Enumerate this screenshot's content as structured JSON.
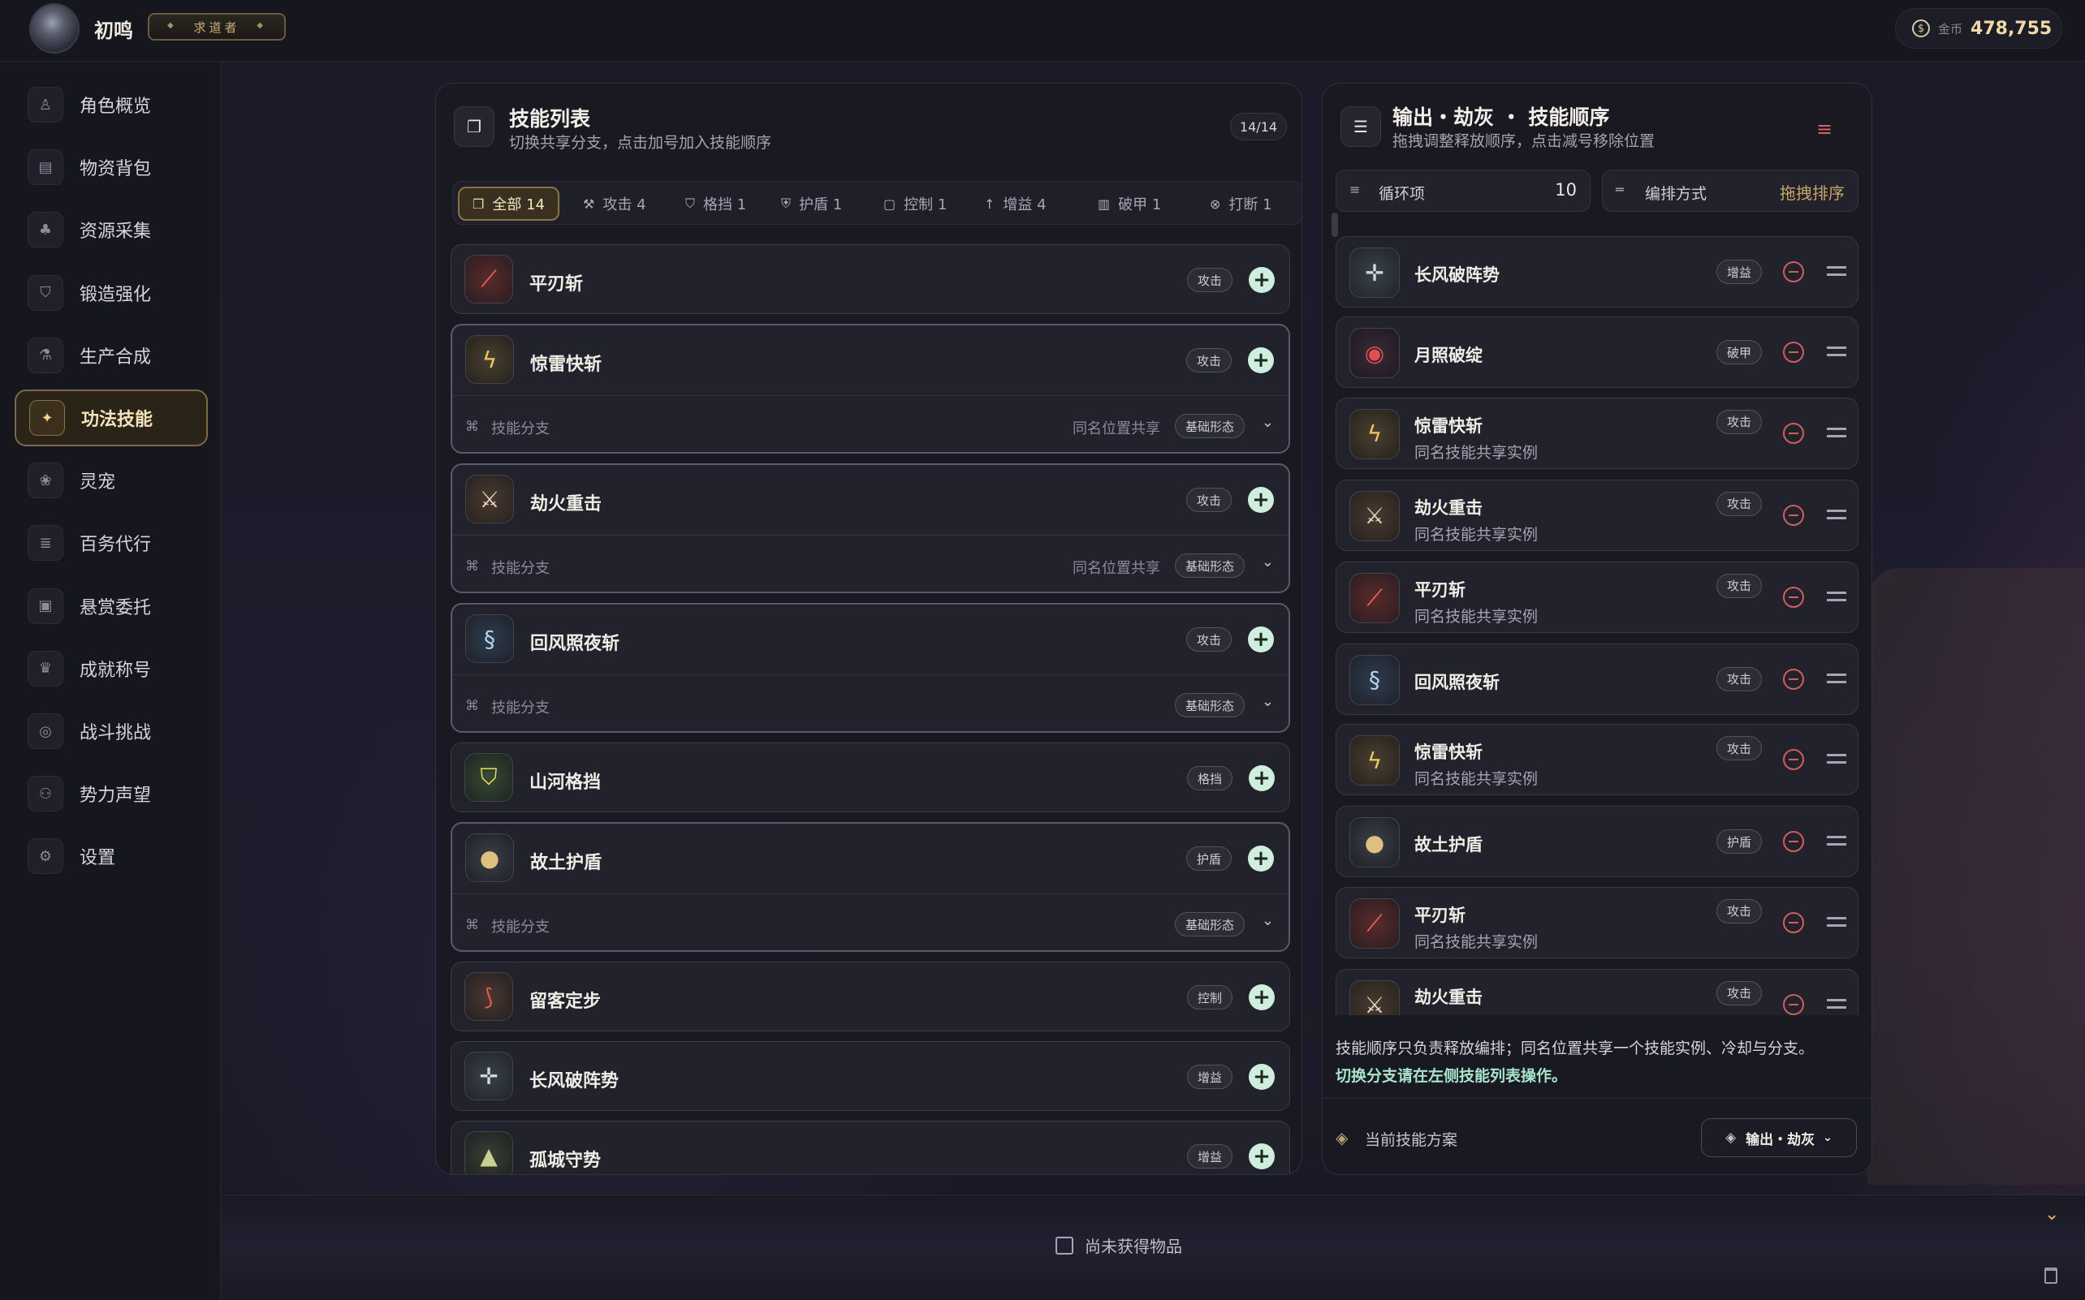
{
  "user": {
    "name": "初鸣",
    "title": "求道者"
  },
  "currency": {
    "label": "金币",
    "value": "478,755"
  },
  "sidebar": {
    "items": [
      {
        "label": "角色概览",
        "icon": "user-icon"
      },
      {
        "label": "物资背包",
        "icon": "backpack-icon"
      },
      {
        "label": "资源采集",
        "icon": "tree-icon"
      },
      {
        "label": "锻造强化",
        "icon": "shield-icon"
      },
      {
        "label": "生产合成",
        "icon": "flask-icon"
      },
      {
        "label": "功法技能",
        "icon": "sparkle-icon",
        "active": true
      },
      {
        "label": "灵宠",
        "icon": "paw-icon"
      },
      {
        "label": "百务代行",
        "icon": "checklist-icon"
      },
      {
        "label": "悬赏委托",
        "icon": "clipboard-icon"
      },
      {
        "label": "成就称号",
        "icon": "trophy-icon"
      },
      {
        "label": "战斗挑战",
        "icon": "target-icon"
      },
      {
        "label": "势力声望",
        "icon": "people-icon"
      },
      {
        "label": "设置",
        "icon": "gear-icon"
      }
    ]
  },
  "skill_list": {
    "title": "技能列表",
    "subtitle": "切换共享分支，点击加号加入技能顺序",
    "count": "14/14",
    "filters": [
      {
        "label": "全部 14",
        "icon": "layers-icon",
        "active": true
      },
      {
        "label": "攻击 4",
        "icon": "hammer-icon"
      },
      {
        "label": "格挡 1",
        "icon": "shield-icon"
      },
      {
        "label": "护盾 1",
        "icon": "shield-check-icon"
      },
      {
        "label": "控制 1",
        "icon": "lock-icon"
      },
      {
        "label": "增益 4",
        "icon": "arrow-up-icon"
      },
      {
        "label": "破甲 1",
        "icon": "armor-icon"
      },
      {
        "label": "打断 1",
        "icon": "cancel-icon"
      },
      {
        "label": "",
        "icon": "star-icon"
      }
    ],
    "branch_label": "技能分支",
    "share_label": "同名位置共享",
    "form_label": "基础形态",
    "skills": [
      {
        "name": "平刃斩",
        "tag": "攻击",
        "icon": "blade-icon",
        "tone": "red"
      },
      {
        "name": "惊雷快斩",
        "tag": "攻击",
        "icon": "lightning-icon",
        "tone": "gold",
        "branch": true,
        "shared": true
      },
      {
        "name": "劫火重击",
        "tag": "攻击",
        "icon": "fire-sword-icon",
        "tone": "fire",
        "branch": true,
        "shared": true
      },
      {
        "name": "回风照夜斩",
        "tag": "攻击",
        "icon": "wind-icon",
        "tone": "blue",
        "branch": true,
        "shared": false
      },
      {
        "name": "山河格挡",
        "tag": "格挡",
        "icon": "shield-icon",
        "tone": "green"
      },
      {
        "name": "故土护盾",
        "tag": "护盾",
        "icon": "round-shield-icon",
        "tone": "shield",
        "branch": true,
        "shared": false
      },
      {
        "name": "留客定步",
        "tag": "控制",
        "icon": "hook-icon",
        "tone": "ctrl"
      },
      {
        "name": "长风破阵势",
        "tag": "增益",
        "icon": "spear-icon",
        "tone": "spear"
      },
      {
        "name": "孤城守势",
        "tag": "增益",
        "icon": "tower-icon",
        "tone": "tower"
      }
    ]
  },
  "sequence": {
    "title": "输出・劫灰 ・ 技能顺序",
    "subtitle": "拖拽调整释放顺序，点击减号移除位置",
    "loop": {
      "label": "循环项",
      "value": "10"
    },
    "arrange": {
      "label": "编排方式",
      "value": "拖拽排序"
    },
    "shared_note": "同名技能共享实例",
    "items": [
      {
        "name": "长风破阵势",
        "tag": "增益",
        "icon": "spear-icon",
        "tone": "spear",
        "shared": false
      },
      {
        "name": "月照破绽",
        "tag": "破甲",
        "icon": "eye-icon",
        "tone": "eye",
        "shared": false
      },
      {
        "name": "惊雷快斩",
        "tag": "攻击",
        "icon": "lightning-icon",
        "tone": "gold",
        "shared": true
      },
      {
        "name": "劫火重击",
        "tag": "攻击",
        "icon": "fire-sword-icon",
        "tone": "fire",
        "shared": true
      },
      {
        "name": "平刃斩",
        "tag": "攻击",
        "icon": "blade-icon",
        "tone": "red",
        "shared": true
      },
      {
        "name": "回风照夜斩",
        "tag": "攻击",
        "icon": "wind-icon",
        "tone": "blue",
        "shared": false
      },
      {
        "name": "惊雷快斩",
        "tag": "攻击",
        "icon": "lightning-icon",
        "tone": "gold",
        "shared": true
      },
      {
        "name": "故土护盾",
        "tag": "护盾",
        "icon": "round-shield-icon",
        "tone": "shield",
        "shared": false
      },
      {
        "name": "平刃斩",
        "tag": "攻击",
        "icon": "blade-icon",
        "tone": "red",
        "shared": true
      },
      {
        "name": "劫火重击",
        "tag": "攻击",
        "icon": "fire-sword-icon",
        "tone": "fire",
        "shared": true
      }
    ],
    "note_line1": "技能顺序只负责释放编排；同名位置共享一个技能实例、冷却与分支。",
    "note_line2": "切换分支请在左侧技能列表操作。",
    "footer_label": "当前技能方案",
    "preset": "输出・劫灰"
  },
  "bottom": {
    "empty_label": "尚未获得物品"
  },
  "colors": {
    "accent_gold": "#c7a566",
    "minus_red": "#d35c5c",
    "plus_green": "#cfeedd"
  }
}
